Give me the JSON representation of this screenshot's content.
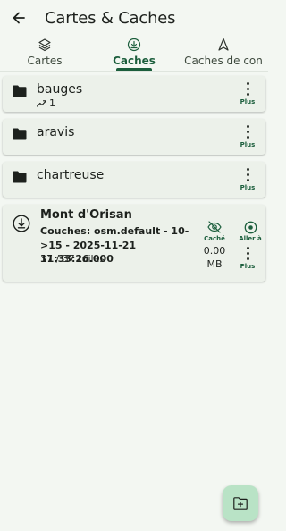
{
  "appbar": {
    "title": "Cartes & Caches",
    "back_icon": "arrow-left-icon"
  },
  "tabs": [
    {
      "label": "Cartes",
      "icon": "layers-icon",
      "active": false
    },
    {
      "label": "Caches",
      "icon": "download-circle-icon",
      "active": true
    },
    {
      "label": "Caches de con",
      "icon": "navigation-arrow-icon",
      "active": false
    }
  ],
  "folders": [
    {
      "name": "bauges",
      "sub_value": "1",
      "sub_icon": "trend-icon",
      "more_label": "Plus"
    },
    {
      "name": "aravis",
      "more_label": "Plus"
    },
    {
      "name": "chartreuse",
      "more_label": "Plus"
    }
  ],
  "cache": {
    "name": "Mont d'Orisan",
    "layers": "Couches: osm.default - 10->15 - 2025-11-21 11:33:26.000",
    "tiles": "37 / 37 tuiles",
    "hide_label": "Caché",
    "size_line1": "0.00",
    "size_line2": "MB",
    "goto_label": "Aller à",
    "more_label": "Plus"
  },
  "fab": {
    "icon": "new-folder-icon"
  },
  "colors": {
    "background": "#f3f7f2",
    "accent": "#1b5e3c",
    "card": "#ecf1ea",
    "fab": "#b9e3c6"
  }
}
